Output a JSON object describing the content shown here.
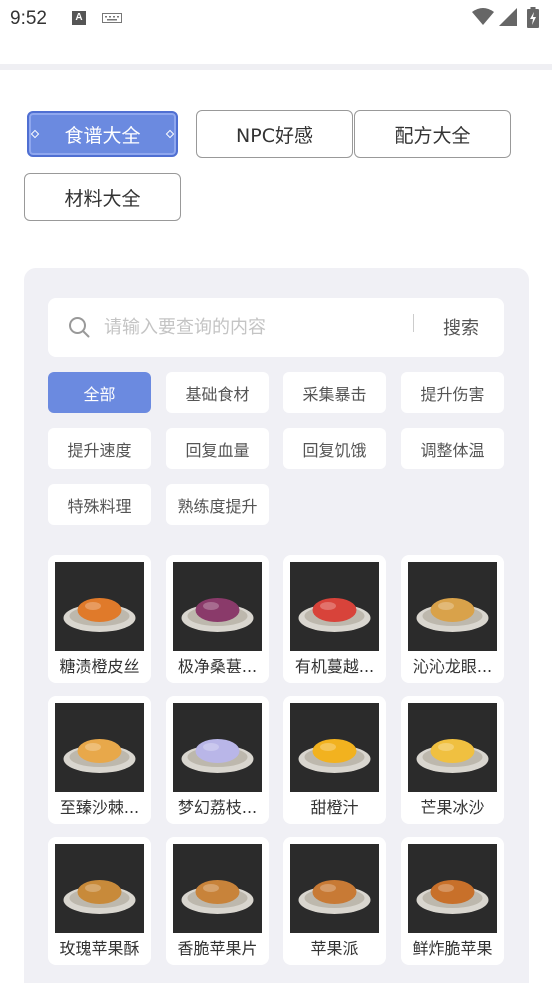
{
  "status_bar": {
    "time": "9:52",
    "app_icon_letter": "A",
    "icons": [
      "text-input-icon",
      "keyboard-icon",
      "wifi-icon",
      "signal-icon",
      "battery-charging-icon"
    ]
  },
  "tabs": [
    {
      "label": "食谱大全",
      "active": true
    },
    {
      "label": "NPC好感",
      "active": false
    },
    {
      "label": "配方大全",
      "active": false
    },
    {
      "label": "材料大全",
      "active": false
    }
  ],
  "search": {
    "placeholder": "请输入要查询的内容",
    "value": "",
    "button_label": "搜索"
  },
  "filters": [
    {
      "label": "全部",
      "active": true
    },
    {
      "label": "基础食材",
      "active": false
    },
    {
      "label": "采集暴击",
      "active": false
    },
    {
      "label": "提升伤害",
      "active": false
    },
    {
      "label": "提升速度",
      "active": false
    },
    {
      "label": "回复血量",
      "active": false
    },
    {
      "label": "回复饥饿",
      "active": false
    },
    {
      "label": "调整体温",
      "active": false
    },
    {
      "label": "特殊料理",
      "active": false
    },
    {
      "label": "熟练度提升",
      "active": false
    }
  ],
  "recipes": [
    {
      "name": "糖渍橙皮丝",
      "icon": "candied-orange-peel-dish-image",
      "accent": "#e07a2a"
    },
    {
      "name": "极净桑葚...",
      "icon": "mulberry-jar-image",
      "accent": "#8a3a6a"
    },
    {
      "name": "有机蔓越...",
      "icon": "cranberry-pizza-image",
      "accent": "#d8433a"
    },
    {
      "name": "沁沁龙眼...",
      "icon": "longan-bowl-image",
      "accent": "#d9a24a"
    },
    {
      "name": "至臻沙棘...",
      "icon": "seabuckthorn-plate-image",
      "accent": "#e8a84a"
    },
    {
      "name": "梦幻荔枝...",
      "icon": "lychee-drink-image",
      "accent": "#b9b6e8"
    },
    {
      "name": "甜橙汁",
      "icon": "orange-juice-image",
      "accent": "#f2b21f"
    },
    {
      "name": "芒果冰沙",
      "icon": "mango-smoothie-image",
      "accent": "#f0c040"
    },
    {
      "name": "玫瑰苹果酥",
      "icon": "rose-apple-pastry-image",
      "accent": "#c88a3a"
    },
    {
      "name": "香脆苹果片",
      "icon": "crispy-apple-chips-image",
      "accent": "#c8833a"
    },
    {
      "name": "苹果派",
      "icon": "apple-pie-image",
      "accent": "#c87a35"
    },
    {
      "name": "鲜炸脆苹果",
      "icon": "fried-apple-image",
      "accent": "#c8702a"
    }
  ],
  "colors": {
    "accent": "#6b8ae0",
    "panel_bg": "#f0f0f5",
    "thumb_bg": "#2b2b2b"
  }
}
